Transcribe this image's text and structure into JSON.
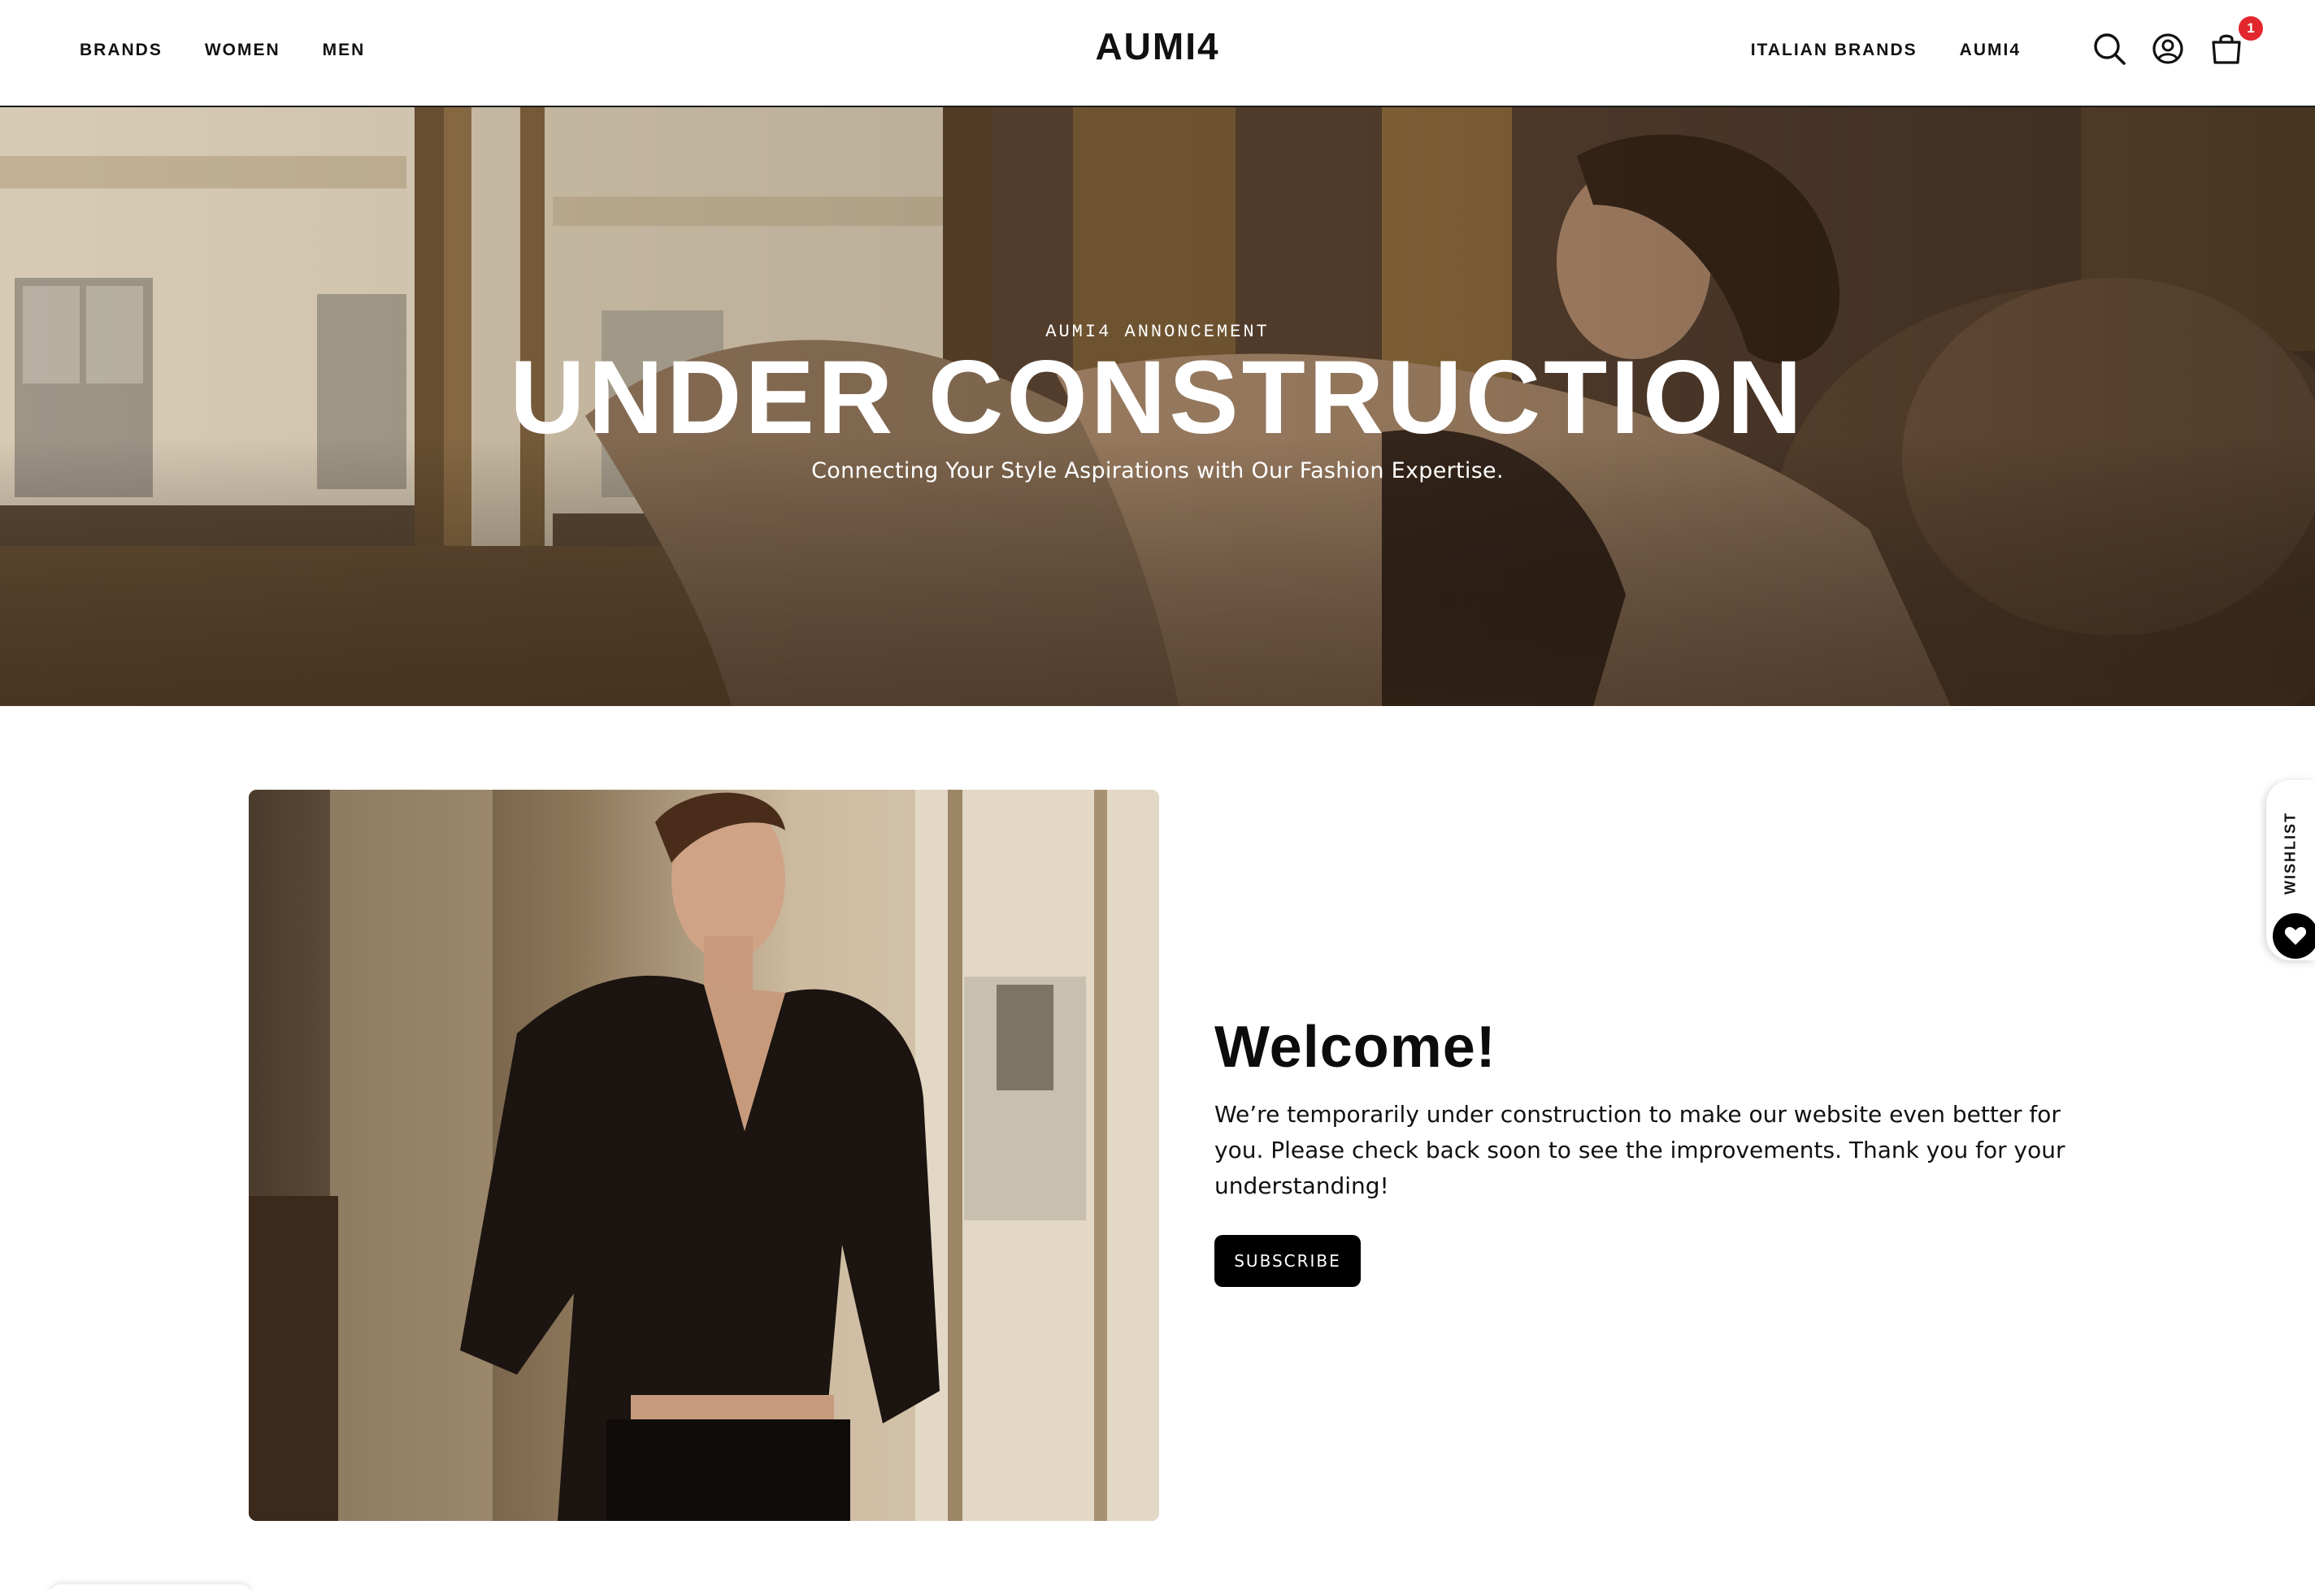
{
  "header": {
    "nav_left": [
      "BRANDS",
      "WOMEN",
      "MEN"
    ],
    "logo": "AUMI4",
    "nav_right": [
      "ITALIAN BRANDS",
      "AUMI4"
    ],
    "cart_count": "1",
    "icons": [
      "search-icon",
      "account-icon",
      "cart-icon"
    ]
  },
  "hero": {
    "eyebrow": "AUMI4 ANNONCEMENT",
    "title": "UNDER CONSTRUCTION",
    "subtitle": "Connecting Your Style Aspirations with Our Fashion Expertise."
  },
  "welcome": {
    "title": "Welcome!",
    "text": "We’re temporarily under construction to make our website even better for you. Please check back soon to see the improvements. Thank you for your understanding!",
    "button_label": "SUBSCRIBE"
  },
  "wishlist": {
    "label": "WISHLIST",
    "icon": "heart-icon"
  },
  "colors": {
    "badge": "#e2262d",
    "button": "#000000",
    "text": "#111111"
  }
}
